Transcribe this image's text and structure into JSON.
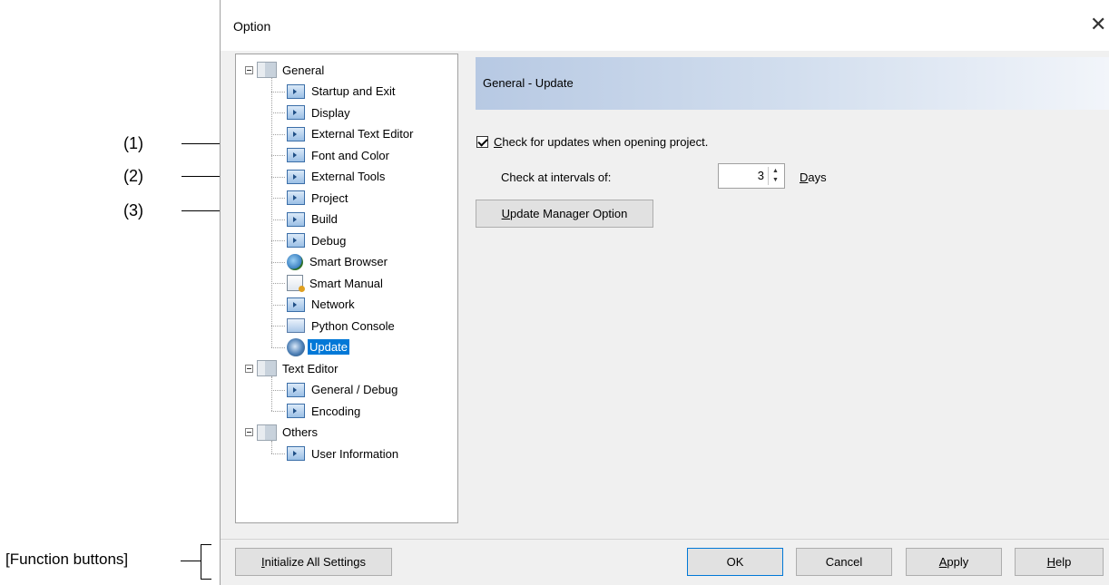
{
  "callouts": {
    "c1": "(1)",
    "c2": "(2)",
    "c3": "(3)",
    "function_buttons": "[Function buttons]"
  },
  "dialog": {
    "title": "Option",
    "close_glyph": "✕"
  },
  "tree": {
    "groups": [
      {
        "label": "General",
        "items": [
          {
            "label": "Startup and Exit",
            "icon": "page-icon"
          },
          {
            "label": "Display",
            "icon": "page-icon"
          },
          {
            "label": "External Text Editor",
            "icon": "page-icon"
          },
          {
            "label": "Font and Color",
            "icon": "page-icon"
          },
          {
            "label": "External Tools",
            "icon": "page-icon"
          },
          {
            "label": "Project",
            "icon": "page-icon"
          },
          {
            "label": "Build",
            "icon": "page-icon"
          },
          {
            "label": "Debug",
            "icon": "page-icon"
          },
          {
            "label": "Smart Browser",
            "icon": "globe-icon"
          },
          {
            "label": "Smart Manual",
            "icon": "manual-icon"
          },
          {
            "label": "Network",
            "icon": "page-icon"
          },
          {
            "label": "Python Console",
            "icon": "python-icon"
          },
          {
            "label": "Update",
            "icon": "update-icon",
            "selected": true
          }
        ]
      },
      {
        "label": "Text Editor",
        "items": [
          {
            "label": "General / Debug",
            "icon": "page-icon"
          },
          {
            "label": "Encoding",
            "icon": "page-icon"
          }
        ]
      },
      {
        "label": "Others",
        "items": [
          {
            "label": "User Information",
            "icon": "page-icon"
          }
        ]
      }
    ]
  },
  "panel": {
    "header": "General - Update",
    "check_mnemonic": "C",
    "check_label_rest": "heck for updates when opening project.",
    "check_checked": true,
    "interval_label": "Check at intervals of:",
    "interval_value": "3",
    "days_mnemonic": "D",
    "days_rest": "ays",
    "update_btn_mnemonic": "U",
    "update_btn_rest": "pdate Manager Option"
  },
  "buttons": {
    "init_mnemonic": "I",
    "init_rest": "nitialize All Settings",
    "ok": "OK",
    "cancel": "Cancel",
    "apply_mnemonic": "A",
    "apply_rest": "pply",
    "help_mnemonic": "H",
    "help_rest": "elp"
  }
}
